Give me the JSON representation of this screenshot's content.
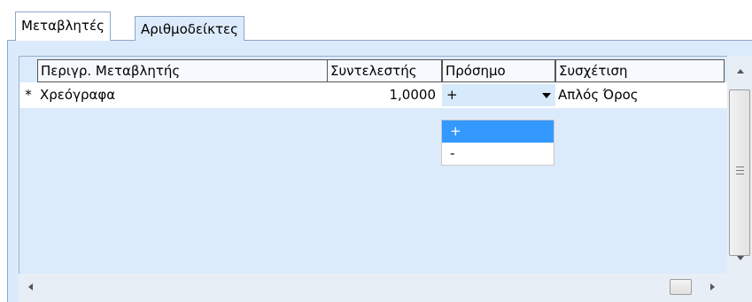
{
  "tabs": [
    {
      "label": "Μεταβλητές",
      "active": true
    },
    {
      "label": "Αριθμοδείκτες",
      "active": false
    }
  ],
  "grid": {
    "columns": [
      "Περιγρ. Μεταβλητής",
      "Συντελεστής",
      "Πρόσημο",
      "Συσχέτιση"
    ],
    "rows": [
      {
        "marker": "*",
        "description": "Χρεόγραφα",
        "coefficient": "1,0000",
        "sign": "+",
        "relation": "Απλός Όρος"
      }
    ]
  },
  "sign_dropdown": {
    "options": [
      "+",
      "-"
    ],
    "selected": "+"
  },
  "colors": {
    "panel_bg": "#dcebfb",
    "dropdown_highlight": "#3399ff",
    "tab_border": "#8da6c7"
  },
  "icons": [
    "dropdown-arrow-icon",
    "scroll-up-icon",
    "scroll-down-icon",
    "scroll-left-icon",
    "scroll-right-icon"
  ]
}
